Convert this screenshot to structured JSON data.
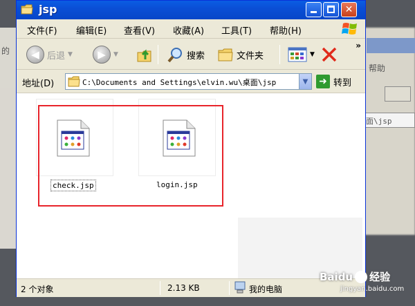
{
  "window": {
    "title": "jsp",
    "controls": {
      "minimize": "_",
      "maximize": "□",
      "close": "✕"
    }
  },
  "menu": {
    "items": [
      "文件(F)",
      "编辑(E)",
      "查看(V)",
      "收藏(A)",
      "工具(T)",
      "帮助(H)"
    ]
  },
  "toolbar": {
    "back_label": "后退",
    "search_label": "搜索",
    "folders_label": "文件夹",
    "more": "»"
  },
  "address": {
    "label": "地址(D)",
    "path": "C:\\Documents and Settings\\elvin.wu\\桌面\\jsp",
    "go_label": "转到"
  },
  "files": [
    {
      "name": "check.jsp",
      "selected": true,
      "icon": "jsp-file-icon"
    },
    {
      "name": "login.jsp",
      "selected": false,
      "icon": "jsp-file-icon"
    }
  ],
  "status": {
    "objects": "2 个对象",
    "size": "2.13 KB",
    "location": "我的电脑"
  },
  "background": {
    "help_text": "帮助",
    "path_fragment": "面\\jsp",
    "left_text": "的"
  },
  "watermark": {
    "brand": "Baidu",
    "suffix": "经验",
    "url": "jingyan.baidu.com"
  },
  "colors": {
    "titlebar": "#0a4fd6",
    "selection_box": "#e8232a",
    "window_face": "#ece9d8"
  }
}
